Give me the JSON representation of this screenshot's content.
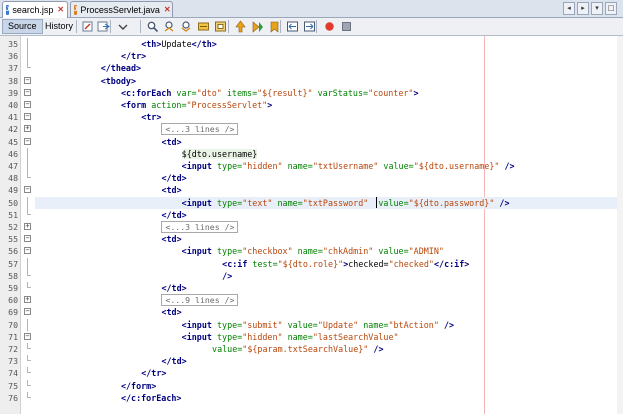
{
  "tabs": [
    {
      "label": "search.jsp",
      "type": "jsp",
      "active": true
    },
    {
      "label": "ProcessServlet.java",
      "type": "java",
      "active": false
    }
  ],
  "toolbar": {
    "views": [
      "Source",
      "History"
    ],
    "active_view": "Source",
    "icons": [
      "last-edit-icon",
      "back-icon",
      "forward-icon",
      "find-selection-icon",
      "find-previous-icon",
      "find-next-icon",
      "toggle-highlight-icon",
      "toggle-rectangular-icon",
      "prev-bookmark-icon",
      "next-bookmark-icon",
      "toggle-bookmark-icon",
      "shift-left-icon",
      "shift-right-icon",
      "start-macro-icon",
      "stop-macro-icon"
    ]
  },
  "colors": {
    "tag": "#000080",
    "attribute": "#008000",
    "string": "#b8460b",
    "highlight": "#e9eff8",
    "margin": "#f2b8b8"
  },
  "lines": [
    {
      "n": "35",
      "fold": "line",
      "indent": 20,
      "parts": [
        [
          "tag",
          "<th>"
        ],
        [
          "txt",
          "Update"
        ],
        [
          "tag",
          "</th>"
        ]
      ]
    },
    {
      "n": "36",
      "fold": "line",
      "indent": 16,
      "parts": [
        [
          "tag",
          "</tr>"
        ]
      ]
    },
    {
      "n": "37",
      "fold": "end",
      "indent": 12,
      "parts": [
        [
          "tag",
          "</thead>"
        ]
      ]
    },
    {
      "n": "38",
      "fold": "minus",
      "indent": 12,
      "parts": [
        [
          "tag",
          "<tbody>"
        ]
      ]
    },
    {
      "n": "39",
      "fold": "minus",
      "indent": 16,
      "parts": [
        [
          "tag",
          "<c:forEach"
        ],
        [
          "txt",
          " "
        ],
        [
          "attr",
          "var="
        ],
        [
          "str",
          "\"dto\""
        ],
        [
          "txt",
          " "
        ],
        [
          "attr",
          "items="
        ],
        [
          "str",
          "\"${result}\""
        ],
        [
          "txt",
          " "
        ],
        [
          "attr",
          "varStatus="
        ],
        [
          "str",
          "\"counter\""
        ],
        [
          "tag",
          ">"
        ]
      ]
    },
    {
      "n": "40",
      "fold": "minus",
      "indent": 16,
      "parts": [
        [
          "tag",
          "<form"
        ],
        [
          "txt",
          " "
        ],
        [
          "attr",
          "action="
        ],
        [
          "str",
          "\"ProcessServlet\""
        ],
        [
          "tag",
          ">"
        ]
      ]
    },
    {
      "n": "41",
      "fold": "minus",
      "indent": 20,
      "parts": [
        [
          "tag",
          "<tr>"
        ]
      ]
    },
    {
      "n": "42",
      "fold": "plus",
      "indent": 24,
      "parts": [
        [
          "col",
          "<...3 lines />"
        ]
      ]
    },
    {
      "n": "45",
      "fold": "minus",
      "indent": 24,
      "parts": [
        [
          "tag",
          "<td>"
        ]
      ]
    },
    {
      "n": "46",
      "fold": "line",
      "indent": 28,
      "parts": [
        [
          "el",
          "${dto.username}"
        ]
      ]
    },
    {
      "n": "47",
      "fold": "line",
      "indent": 28,
      "parts": [
        [
          "tag",
          "<input"
        ],
        [
          "txt",
          " "
        ],
        [
          "attr",
          "type="
        ],
        [
          "str",
          "\"hidden\""
        ],
        [
          "txt",
          " "
        ],
        [
          "attr",
          "name="
        ],
        [
          "str",
          "\"txtUsername\""
        ],
        [
          "txt",
          " "
        ],
        [
          "attr",
          "value="
        ],
        [
          "str",
          "\"${dto.username}\""
        ],
        [
          "txt",
          " "
        ],
        [
          "tag",
          "/>"
        ]
      ]
    },
    {
      "n": "48",
      "fold": "end",
      "indent": 24,
      "parts": [
        [
          "tag",
          "</td>"
        ]
      ]
    },
    {
      "n": "49",
      "fold": "minus",
      "indent": 24,
      "parts": [
        [
          "tag",
          "<td>"
        ]
      ]
    },
    {
      "n": "50",
      "fold": "line",
      "indent": 28,
      "hl": true,
      "parts": [
        [
          "tag",
          "<input"
        ],
        [
          "txt",
          " "
        ],
        [
          "attr",
          "type="
        ],
        [
          "str",
          "\"text\""
        ],
        [
          "txt",
          " "
        ],
        [
          "attr",
          "name="
        ],
        [
          "str",
          "\"txtPassword\""
        ],
        [
          "txt",
          "  "
        ],
        [
          "attr",
          "value="
        ],
        [
          "str",
          "\"${dto.password}\""
        ],
        [
          "txt",
          " "
        ],
        [
          "tag",
          "/>"
        ]
      ]
    },
    {
      "n": "51",
      "fold": "end",
      "indent": 24,
      "parts": [
        [
          "tag",
          "</td>"
        ]
      ]
    },
    {
      "n": "52",
      "fold": "plus",
      "indent": 24,
      "parts": [
        [
          "col",
          "<...3 lines />"
        ]
      ]
    },
    {
      "n": "55",
      "fold": "minus",
      "indent": 24,
      "parts": [
        [
          "tag",
          "<td>"
        ]
      ]
    },
    {
      "n": "56",
      "fold": "minus",
      "indent": 28,
      "parts": [
        [
          "tag",
          "<input"
        ],
        [
          "txt",
          " "
        ],
        [
          "attr",
          "type="
        ],
        [
          "str",
          "\"checkbox\""
        ],
        [
          "txt",
          " "
        ],
        [
          "attr",
          "name="
        ],
        [
          "str",
          "\"chkAdmin\""
        ],
        [
          "txt",
          " "
        ],
        [
          "attr",
          "value="
        ],
        [
          "str",
          "\"ADMIN\""
        ]
      ]
    },
    {
      "n": "57",
      "fold": "line",
      "indent": 36,
      "parts": [
        [
          "tag",
          "<c:if"
        ],
        [
          "txt",
          " "
        ],
        [
          "attr",
          "test="
        ],
        [
          "str",
          "\"${dto.role}\""
        ],
        [
          "tag",
          ">"
        ],
        [
          "txt",
          "checked="
        ],
        [
          "str",
          "\"checked\""
        ],
        [
          "tag",
          "</c:if>"
        ]
      ]
    },
    {
      "n": "58",
      "fold": "end",
      "indent": 36,
      "parts": [
        [
          "tag",
          "/>"
        ]
      ]
    },
    {
      "n": "59",
      "fold": "end",
      "indent": 24,
      "parts": [
        [
          "tag",
          "</td>"
        ]
      ]
    },
    {
      "n": "60",
      "fold": "plus",
      "indent": 24,
      "parts": [
        [
          "col",
          "<...9 lines />"
        ]
      ]
    },
    {
      "n": "69",
      "fold": "minus",
      "indent": 24,
      "parts": [
        [
          "tag",
          "<td>"
        ]
      ]
    },
    {
      "n": "70",
      "fold": "line",
      "indent": 28,
      "parts": [
        [
          "tag",
          "<input"
        ],
        [
          "txt",
          " "
        ],
        [
          "attr",
          "type="
        ],
        [
          "str",
          "\"submit\""
        ],
        [
          "txt",
          " "
        ],
        [
          "attr",
          "value="
        ],
        [
          "str",
          "\"Update\""
        ],
        [
          "txt",
          " "
        ],
        [
          "attr",
          "name="
        ],
        [
          "str",
          "\"btAction\""
        ],
        [
          "txt",
          " "
        ],
        [
          "tag",
          "/>"
        ]
      ]
    },
    {
      "n": "71",
      "fold": "minus",
      "indent": 28,
      "parts": [
        [
          "tag",
          "<input"
        ],
        [
          "txt",
          " "
        ],
        [
          "attr",
          "type="
        ],
        [
          "str",
          "\"hidden\""
        ],
        [
          "txt",
          " "
        ],
        [
          "attr",
          "name="
        ],
        [
          "str",
          "\"lastSearchValue\""
        ]
      ]
    },
    {
      "n": "72",
      "fold": "end",
      "indent": 34,
      "parts": [
        [
          "attr",
          "value="
        ],
        [
          "str",
          "\"${param.txtSearchValue}\""
        ],
        [
          "txt",
          " "
        ],
        [
          "tag",
          "/>"
        ]
      ]
    },
    {
      "n": "73",
      "fold": "end",
      "indent": 24,
      "parts": [
        [
          "tag",
          "</td>"
        ]
      ]
    },
    {
      "n": "74",
      "fold": "end",
      "indent": 20,
      "parts": [
        [
          "tag",
          "</tr>"
        ]
      ]
    },
    {
      "n": "75",
      "fold": "end",
      "indent": 16,
      "parts": [
        [
          "tag",
          "</form>"
        ]
      ]
    },
    {
      "n": "76",
      "fold": "end",
      "indent": 16,
      "parts": [
        [
          "tag",
          "</c:forEach>"
        ]
      ]
    }
  ]
}
